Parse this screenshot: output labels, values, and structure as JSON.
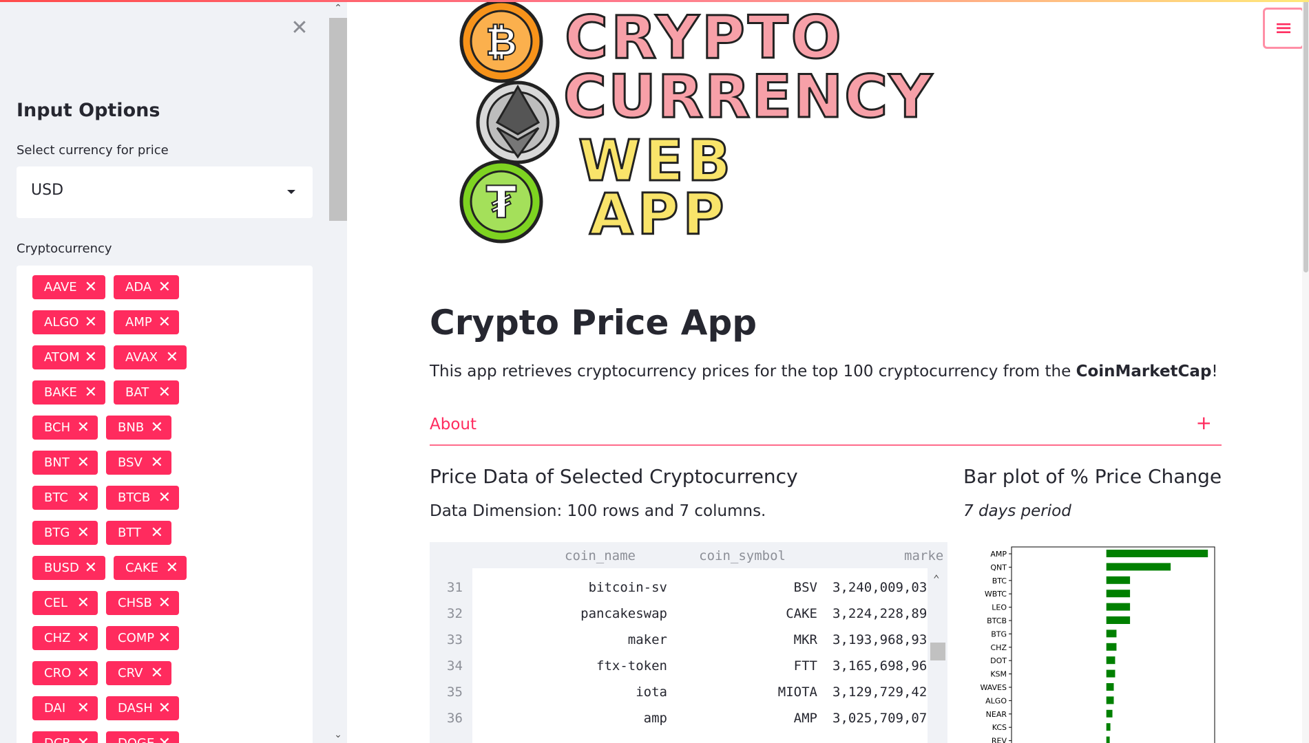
{
  "sidebar": {
    "close_icon": "close-icon",
    "title": "Input Options",
    "currency_label": "Select currency for price",
    "currency_value": "USD",
    "crypto_label": "Cryptocurrency",
    "tags": [
      "AAVE",
      "ADA",
      "ALGO",
      "AMP",
      "ATOM",
      "AVAX",
      "BAKE",
      "BAT",
      "BCH",
      "BNB",
      "BNT",
      "BSV",
      "BTC",
      "BTCB",
      "BTG",
      "BTT",
      "BUSD",
      "CAKE",
      "CEL",
      "CHSB",
      "CHZ",
      "COMP",
      "CRO",
      "CRV",
      "DAI",
      "DASH",
      "DCR",
      "DOGE"
    ]
  },
  "main": {
    "title": "Crypto Price App",
    "description": "This app retrieves cryptocurrency prices for the top 100 cryptocurrency from the ",
    "description_bold": "CoinMarketCap",
    "description_end": "!",
    "about_label": "About",
    "about_toggle": "+",
    "price_heading": "Price Data of Selected Cryptocurrency",
    "dimension_text": "Data Dimension: 100 rows and 7 columns.",
    "bar_heading": "Bar plot of % Price Change",
    "period_text": "7 days period"
  },
  "logo": {
    "line1": "CRYPTO",
    "line2": "CURRENCY",
    "line3": "WEB",
    "line4": "APP",
    "coins": [
      "bitcoin-icon",
      "ethereum-icon",
      "tether-icon"
    ]
  },
  "table": {
    "columns": [
      "coin_name",
      "coin_symbol",
      "marke"
    ],
    "rows": [
      {
        "index": "31",
        "name": "bitcoin-sv",
        "symbol": "BSV",
        "market": "3,240,009,03"
      },
      {
        "index": "32",
        "name": "pancakeswap",
        "symbol": "CAKE",
        "market": "3,224,228,89"
      },
      {
        "index": "33",
        "name": "maker",
        "symbol": "MKR",
        "market": "3,193,968,93"
      },
      {
        "index": "34",
        "name": "ftx-token",
        "symbol": "FTT",
        "market": "3,165,698,96"
      },
      {
        "index": "35",
        "name": "iota",
        "symbol": "MIOTA",
        "market": "3,129,729,42"
      },
      {
        "index": "36",
        "name": "amp",
        "symbol": "AMP",
        "market": "3,025,709,07"
      }
    ]
  },
  "chart_data": {
    "type": "bar",
    "orientation": "horizontal",
    "title": "",
    "xlabel": "",
    "ylabel": "",
    "categories": [
      "AMP",
      "QNT",
      "BTC",
      "WBTC",
      "LEO",
      "BTCB",
      "BTG",
      "CHZ",
      "DOT",
      "KSM",
      "WAVES",
      "ALGO",
      "NEAR",
      "KCS",
      "REV"
    ],
    "values": [
      30,
      19,
      7,
      7,
      7,
      7,
      3,
      3,
      2.6,
      2.6,
      2.2,
      2.2,
      1.8,
      1.2,
      1
    ],
    "xlim": [
      -28,
      32
    ],
    "grid": false,
    "colors": {
      "bar": "#008000"
    }
  },
  "colors": {
    "accent": "#ff2b5e",
    "sidebar_bg": "#f0f2f6"
  }
}
